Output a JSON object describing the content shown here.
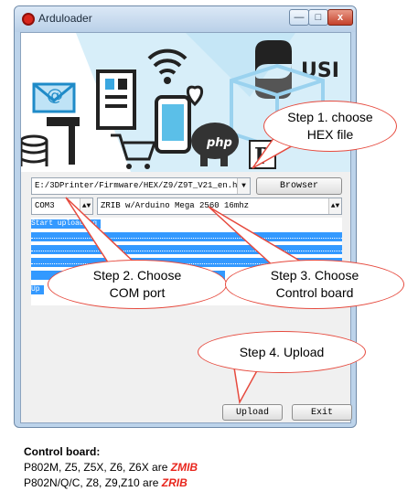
{
  "window": {
    "title": "Arduloader",
    "controls": {
      "minimize": "—",
      "maximize": "□",
      "close": "x"
    }
  },
  "banner": {
    "icons": [
      "email-icon",
      "device-icon",
      "wifi-icon",
      "heart-icon",
      "phone-icon",
      "python-logo",
      "hammer-icon",
      "cart-icon",
      "php-logo",
      "database-icon",
      "perl-logo",
      "box-icon"
    ],
    "php_text": "php",
    "perl_text": "P",
    "usb_text": "USI"
  },
  "file_row": {
    "path_value": "E:/3DPrinter/Firmware/HEX/Z9/Z9T_V21_en.hex",
    "browse_label": "Browser"
  },
  "port_row": {
    "port_value": "COM3",
    "board_value": "ZRIB w/Arduino Mega 2560 16mhz"
  },
  "log": {
    "first_line": "Start uploading",
    "partial_line": "Up"
  },
  "buttons": {
    "upload_label": "Upload",
    "exit_label": "Exit"
  },
  "callouts": {
    "step1": "Step 1. choose HEX file",
    "step2": "Step 2. Choose COM port",
    "step3": "Step 3. Choose Control board",
    "step4": "Step 4. Upload"
  },
  "footer": {
    "heading": "Control board:",
    "line1_models": "P802M, Z5, Z5X, Z6, Z6X are",
    "line1_board": "ZMIB",
    "line2_models": "P802N/Q/C, Z8, Z9,Z10 are",
    "line2_board": "ZRIB"
  },
  "colors": {
    "callout_border": "#e64a3e",
    "log_highlight": "#3399ff",
    "board_highlight": "#e8251c"
  }
}
